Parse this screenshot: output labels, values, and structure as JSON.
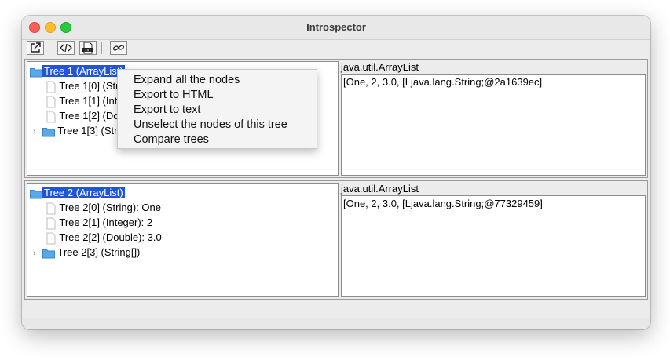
{
  "window": {
    "title": "Introspector"
  },
  "toolbar": {
    "buttons": [
      {
        "icon": "open-external-icon"
      },
      {
        "icon": "code-tags-icon"
      },
      {
        "icon": "txt-file-icon",
        "label": "TXT"
      },
      {
        "icon": "link-icon"
      }
    ]
  },
  "tree1": {
    "root": "Tree 1 (ArrayList)",
    "items": [
      "Tree 1[0] (Stri",
      "Tree 1[1] (Inte",
      "Tree 1[2] (Dou",
      "Tree 1[3] (Strin"
    ]
  },
  "tree1_detail": {
    "title": "java.util.ArrayList",
    "value": "[One, 2, 3.0, [Ljava.lang.String;@2a1639ec]"
  },
  "tree2": {
    "root": "Tree 2 (ArrayList)",
    "items": [
      "Tree 2[0] (String): One",
      "Tree 2[1] (Integer): 2",
      "Tree 2[2] (Double): 3.0",
      "Tree 2[3] (String[])"
    ]
  },
  "tree2_detail": {
    "title": "java.util.ArrayList",
    "value": "[One, 2, 3.0, [Ljava.lang.String;@77329459]"
  },
  "context_menu": {
    "items": [
      "Expand all the nodes",
      "Export to HTML",
      "Export to text",
      "Unselect the nodes of this tree",
      "Compare trees"
    ]
  },
  "colors": {
    "selection": "#2155d6",
    "folder": "#5aa9e6"
  }
}
